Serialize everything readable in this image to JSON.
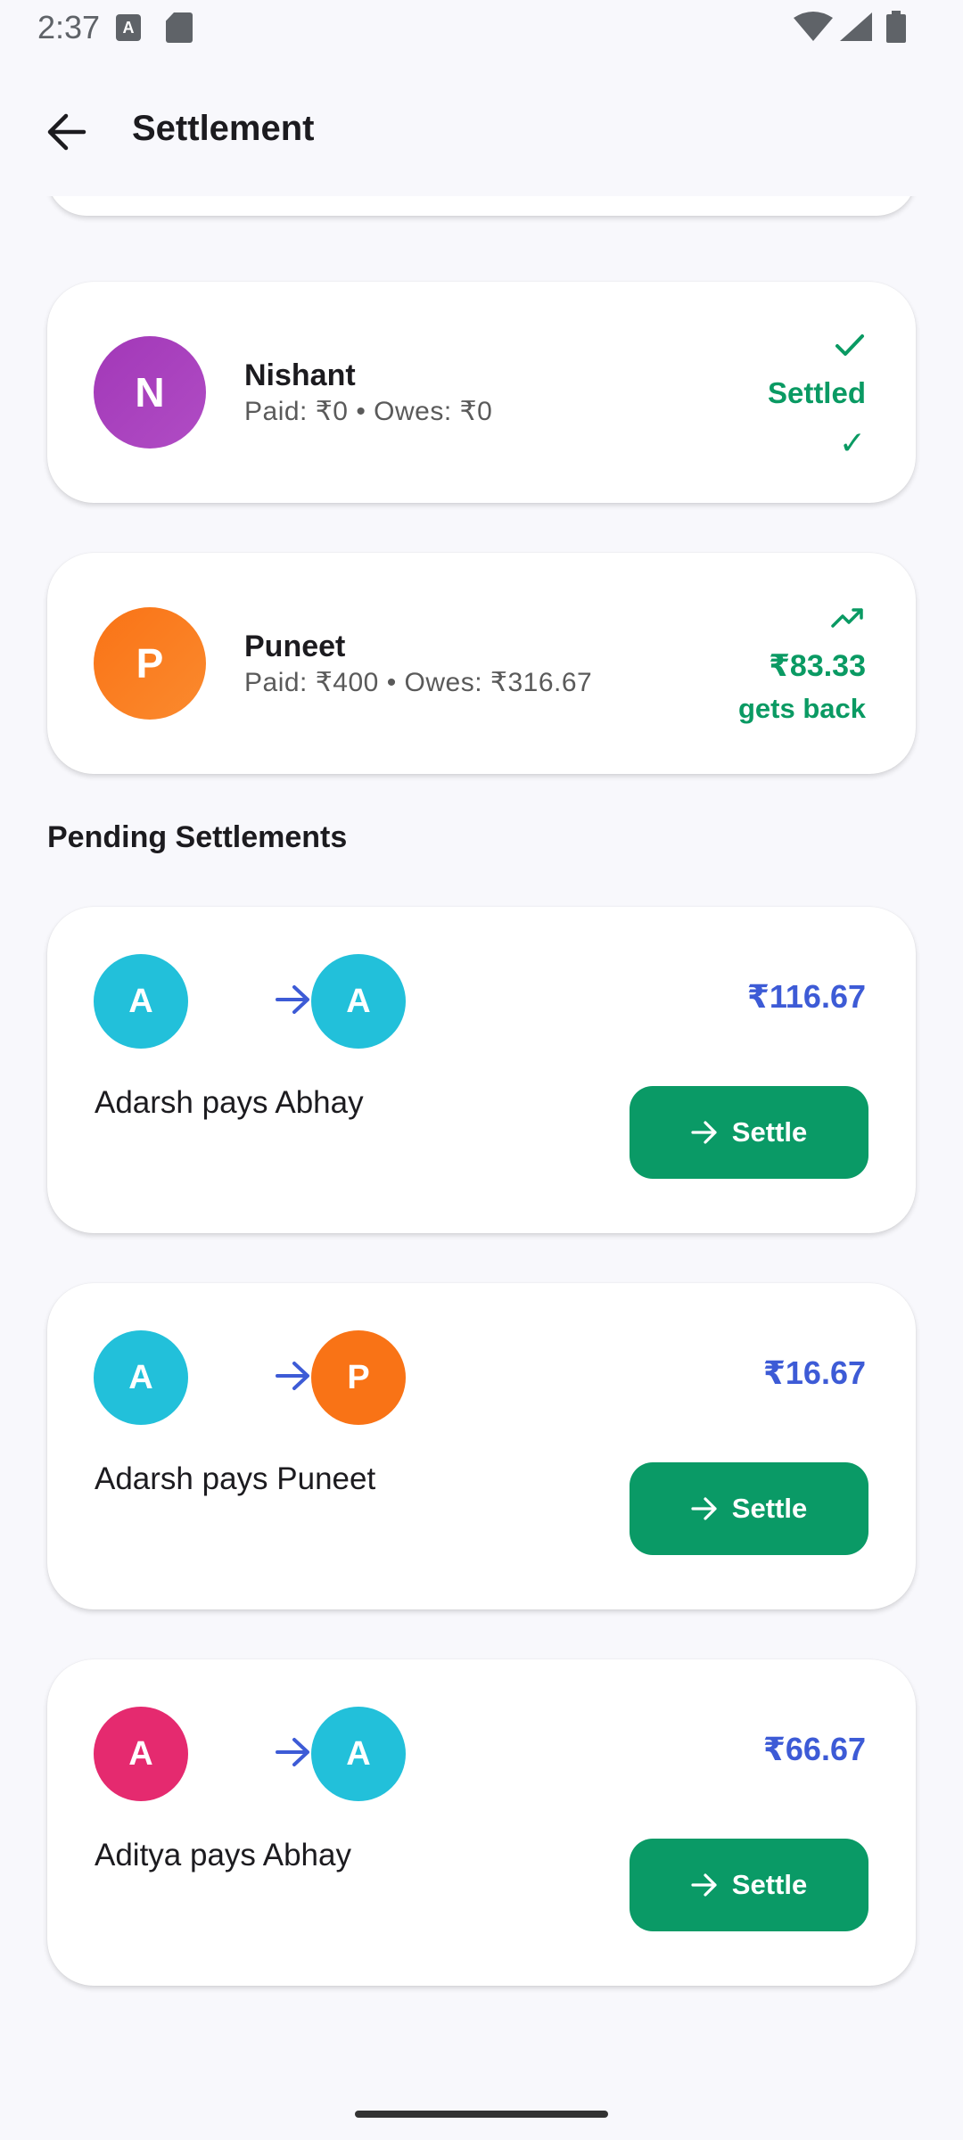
{
  "status_bar": {
    "time": "2:37",
    "icons": [
      "a-notification-icon",
      "sd-card-icon",
      "wifi-icon",
      "signal-icon",
      "battery-icon"
    ]
  },
  "app_bar": {
    "title": "Settlement",
    "back_icon": "arrow-left-icon"
  },
  "colors": {
    "green": "#0a9a63",
    "blue": "#3d5bd6",
    "settle_button": "#0a9a66",
    "avatar_purple": "#9c3bb5",
    "avatar_orange": "#f97316",
    "avatar_cyan": "#22c0da",
    "avatar_pink": "#e52a6f"
  },
  "members": [
    {
      "initial": "N",
      "name": "Nishant",
      "summary": "Paid: ₹0 • Owes: ₹0",
      "status_label": "Settled",
      "status_icon": "check-icon",
      "status_check": "✓",
      "avatar_color": "#9c3bb5"
    },
    {
      "initial": "P",
      "name": "Puneet",
      "summary": "Paid: ₹400 • Owes: ₹316.67",
      "amount": "₹83.33",
      "status_label": "gets back",
      "status_icon": "trending-up-icon",
      "avatar_color": "#f97316"
    }
  ],
  "pending_section": {
    "title": "Pending Settlements"
  },
  "settlements": [
    {
      "from_initial": "A",
      "from_color": "#22c0da",
      "to_initial": "A",
      "to_color": "#22c0da",
      "amount": "₹116.67",
      "description": "Adarsh pays Abhay",
      "button_label": "Settle"
    },
    {
      "from_initial": "A",
      "from_color": "#22c0da",
      "to_initial": "P",
      "to_color": "#f97316",
      "amount": "₹16.67",
      "description": "Adarsh pays Puneet",
      "button_label": "Settle"
    },
    {
      "from_initial": "A",
      "from_color": "#e52a6f",
      "to_initial": "A",
      "to_color": "#22c0da",
      "amount": "₹66.67",
      "description": "Aditya pays Abhay",
      "button_label": "Settle"
    }
  ]
}
